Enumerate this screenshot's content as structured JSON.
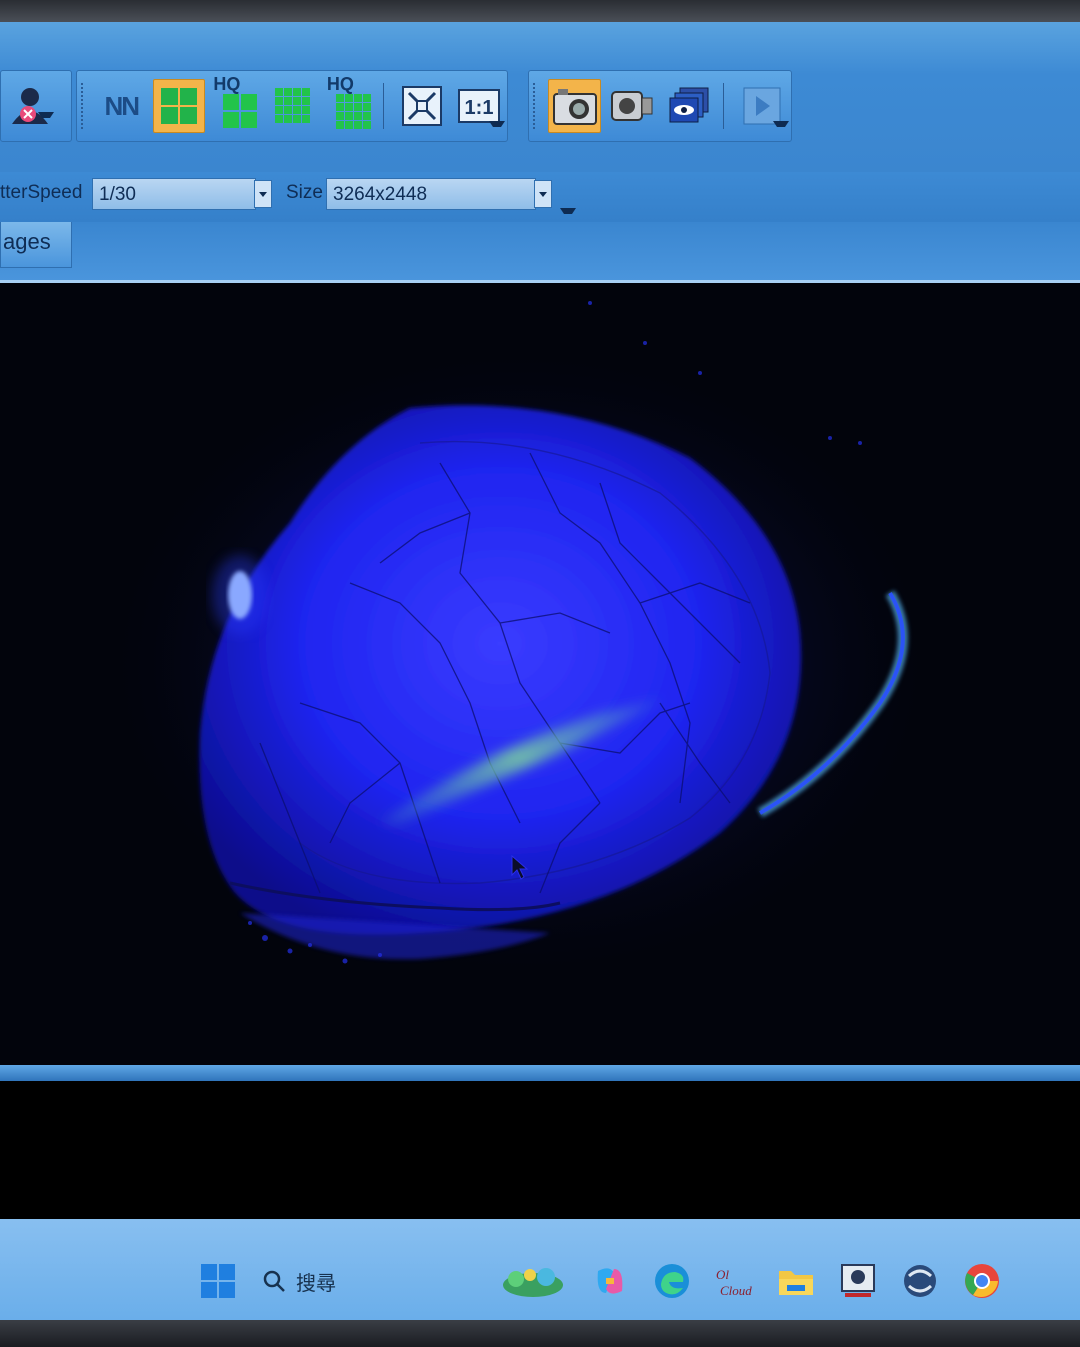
{
  "toolbar": {
    "nn_label": "NN",
    "hq_label_1": "HQ",
    "hq_label_2": "HQ",
    "ratio_label": "1:1"
  },
  "params": {
    "shutter_label": "tterSpeed",
    "shutter_value": "1/30",
    "size_label": "Size",
    "size_value": "3264x2448"
  },
  "tabs": {
    "images_label": "ages"
  },
  "taskbar": {
    "search_placeholder": "搜尋",
    "cloud_label": "Cloud"
  },
  "colors": {
    "ui_blue": "#3d8ad4",
    "active_button": "#f3b44a",
    "fluorescence_blue": "#1d2bff",
    "stain_green": "#7bd0a0"
  }
}
